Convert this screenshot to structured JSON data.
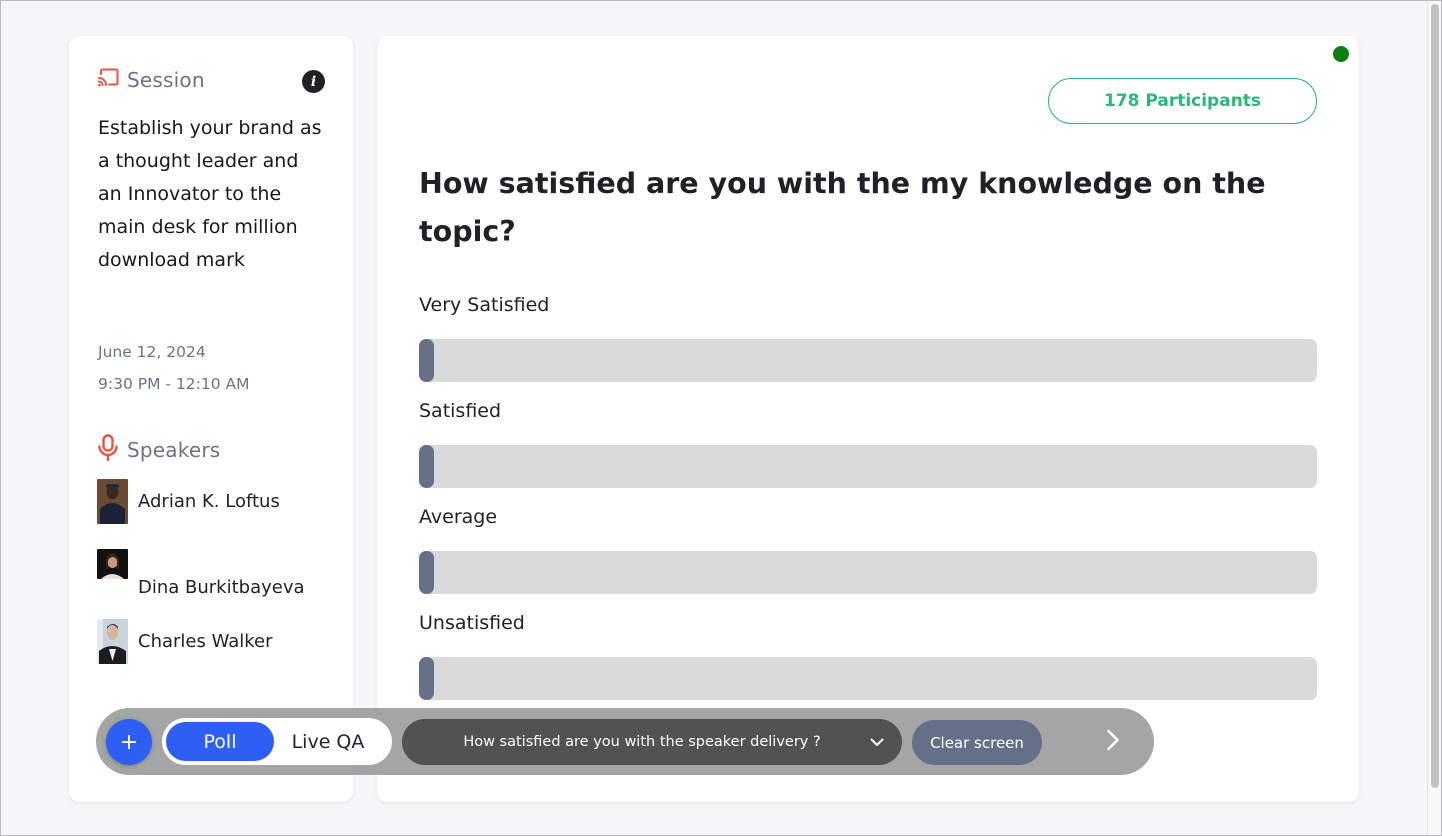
{
  "sidebar": {
    "session": {
      "heading": "Session",
      "icon": "cast-icon",
      "info_icon": "i",
      "title": "Establish your brand as a thought leader and an Innovator to the main desk for million download mark",
      "date": "June 12, 2024",
      "time": "9:30 PM - 12:10 AM"
    },
    "speakers": {
      "heading": "Speakers",
      "icon": "microphone-icon",
      "items": [
        {
          "name": "Adrian K. Loftus"
        },
        {
          "name": "Dina Burkitbayeva"
        },
        {
          "name": "Charles Walker"
        }
      ]
    }
  },
  "main": {
    "status": {
      "color": "#0d7f12",
      "label": "live"
    },
    "participants_label": "178 Participants",
    "question": "How satisfied are you with the my knowledge on the topic?",
    "options": [
      {
        "label": "Very Satisfied",
        "percent": 0
      },
      {
        "label": "Satisfied",
        "percent": 0
      },
      {
        "label": "Average",
        "percent": 0
      },
      {
        "label": "Unsatisfied",
        "percent": 0
      }
    ]
  },
  "toolbar": {
    "add_label": "+",
    "tabs": [
      {
        "label": "Poll",
        "active": true
      },
      {
        "label": "Live QA",
        "active": false
      }
    ],
    "poll_select_value": "How satisfied are you with the speaker delivery ?",
    "clear_label": "Clear screen"
  },
  "colors": {
    "accent": "#2e5ff5",
    "participants": "#2bb77a",
    "icon_red": "#e8524a",
    "bar_fill": "#677086",
    "bar_track": "#dadada"
  }
}
